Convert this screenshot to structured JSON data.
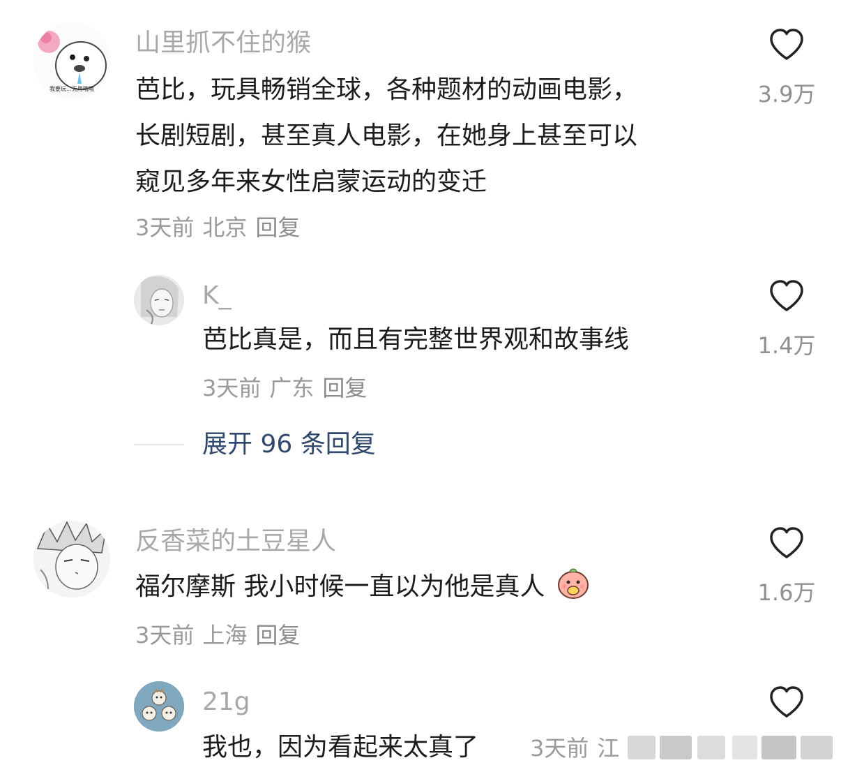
{
  "comments": [
    {
      "username": "山里抓不住的猴",
      "lines": [
        "芭比，玩具畅销全球，各种题材的动画电影，",
        "长剧短剧，甚至真人电影，在她身上甚至可以",
        "窥见多年来女性启蒙运动的变迁"
      ],
      "time": "3天前",
      "location": "北京",
      "reply_label": "回复",
      "likes": "3.9万",
      "avatar_caption": "我要玩…无用哦哦",
      "icon": "heart-outline-icon"
    },
    {
      "username": "K_",
      "lines": [
        "芭比真是，而且有完整世界观和故事线"
      ],
      "time": "3天前",
      "location": "广东",
      "reply_label": "回复",
      "likes": "1.4万",
      "icon": "heart-outline-icon"
    },
    {
      "username": "反香菜的土豆星人",
      "lines": [
        "福尔摩斯 我小时候一直以为他是真人"
      ],
      "time": "3天前",
      "location": "上海",
      "reply_label": "回复",
      "likes": "1.6万",
      "icon": "heart-outline-icon"
    },
    {
      "username": "21g",
      "lines": [
        "我也，因为看起来太真了"
      ],
      "time": "3天前",
      "location": "江",
      "icon": "heart-outline-icon"
    }
  ],
  "expand": {
    "label": "展开 96 条回复"
  },
  "colors": {
    "username": "#a8a8a8",
    "body": "#1c1c1c",
    "meta": "#9a9a9a",
    "expand": "#30486e",
    "like_icon": "#222222"
  }
}
